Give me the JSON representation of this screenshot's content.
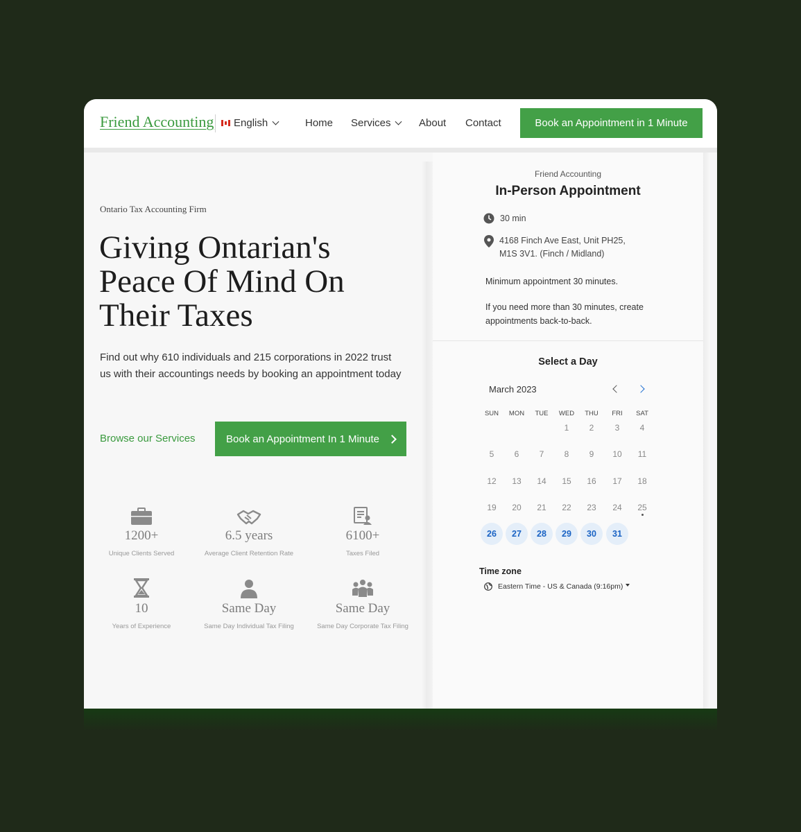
{
  "header": {
    "logo": "Friend Accounting",
    "language": "English",
    "nav": [
      "Home",
      "Services",
      "About",
      "Contact"
    ],
    "cta": "Book an Appointment in 1 Minute"
  },
  "hero": {
    "eyebrow": "Ontario Tax Accounting Firm",
    "headline": "Giving Ontarian's Peace Of Mind On Their Taxes",
    "lead": "Find out why 610 individuals and 215 corporations in 2022 trust us with their accountings needs by booking an appointment today",
    "browse_link": "Browse our Services",
    "cta": "Book an Appointment In 1 Minute"
  },
  "stats": [
    {
      "icon": "briefcase-icon",
      "value": "1200+",
      "caption": "Unique Clients Served"
    },
    {
      "icon": "handshake-icon",
      "value": "6.5 years",
      "caption": "Average Client Retention Rate"
    },
    {
      "icon": "document-user-icon",
      "value": "6100+",
      "caption": "Taxes Filed"
    },
    {
      "icon": "hourglass-icon",
      "value": "10",
      "caption": "Years of Experience"
    },
    {
      "icon": "person-icon",
      "value": "Same Day",
      "caption": "Same Day Individual Tax Filing"
    },
    {
      "icon": "group-icon",
      "value": "Same Day",
      "caption": "Same Day Corporate Tax Filing"
    }
  ],
  "booking": {
    "firm": "Friend Accounting",
    "title": "In-Person Appointment",
    "duration": "30 min",
    "address_line1": "4168 Finch Ave East, Unit PH25,",
    "address_line2": "M1S 3V1. (Finch / Midland)",
    "note1": "Minimum appointment 30 minutes.",
    "note2": "If you need more than 30 minutes, create appointments back-to-back.",
    "select_day": "Select a Day",
    "month": "March 2023",
    "weekdays": [
      "SUN",
      "MON",
      "TUE",
      "WED",
      "THU",
      "FRI",
      "SAT"
    ],
    "weeks": [
      [
        "",
        "",
        "",
        "1",
        "2",
        "3",
        "4"
      ],
      [
        "5",
        "6",
        "7",
        "8",
        "9",
        "10",
        "11"
      ],
      [
        "12",
        "13",
        "14",
        "15",
        "16",
        "17",
        "18"
      ],
      [
        "19",
        "20",
        "21",
        "22",
        "23",
        "24",
        "25"
      ],
      [
        "26",
        "27",
        "28",
        "29",
        "30",
        "31",
        ""
      ]
    ],
    "available_days": [
      "26",
      "27",
      "28",
      "29",
      "30",
      "31"
    ],
    "today": "25",
    "timezone_label": "Time zone",
    "timezone": "Eastern Time - US & Canada (9:16pm)"
  },
  "colors": {
    "brand_green": "#43a047",
    "accent_blue": "#1a63c4",
    "background": "#1f2a19"
  }
}
